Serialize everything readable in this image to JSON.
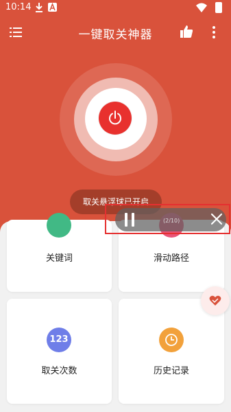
{
  "status_bar": {
    "time": "10:14"
  },
  "app_bar": {
    "title": "一键取关神器"
  },
  "toast": {
    "text": "取关悬浮球已开启"
  },
  "grid": {
    "keywords": {
      "label": "关键词"
    },
    "swipe_path": {
      "label": "滑动路径"
    },
    "unfollow_count": {
      "label": "取关次数",
      "icon_text": "123"
    },
    "history": {
      "label": "历史记录"
    }
  },
  "floating_bar": {
    "progress": "(2/10)"
  },
  "colors": {
    "header": "#d9523b",
    "power": "#e8312e",
    "keywords_icon": "#41b985",
    "path_icon": "#e95478",
    "count_icon": "#6f7ee8",
    "history_icon": "#f2a13b"
  }
}
